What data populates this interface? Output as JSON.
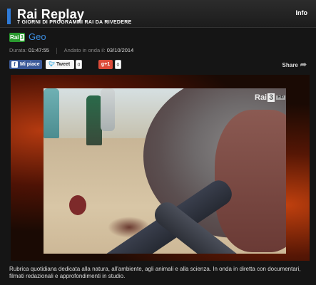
{
  "header": {
    "title": "Rai Replay",
    "subtitle": "7 GIORNI DI PROGRAMMI RAI DA RIVEDERE",
    "info_label": "Info"
  },
  "program": {
    "channel_logo_text": "Rai",
    "channel_logo_number": "3",
    "title": "Geo"
  },
  "meta": {
    "duration_label": "Durata:",
    "duration_value": "01:47:55",
    "aired_label": "Andato in onda il:",
    "aired_value": "03/10/2014"
  },
  "social": {
    "facebook_label": "Mi piace",
    "facebook_count": "",
    "tweet_label": "Tweet",
    "tweet_count": "0",
    "gplus_label": "g+1",
    "gplus_count": "0",
    "share_label": "Share"
  },
  "player": {
    "logo_text": "Rai",
    "logo_number": "3",
    "logo_hd": "HD"
  },
  "description": "Rubrica quotidiana dedicata alla natura, all'ambiente, agli animali e alla scienza. In onda in diretta con documentari, filmati redazionali e approfondimenti in studio.",
  "colors": {
    "accent": "#2f7bd8",
    "title_link": "#3c8ee0",
    "channel_green": "#2a9a2f",
    "facebook": "#3b5998",
    "gplus": "#dd4b39"
  },
  "icons": [
    "facebook-icon",
    "twitter-bird-icon",
    "share-arrow-icon"
  ]
}
